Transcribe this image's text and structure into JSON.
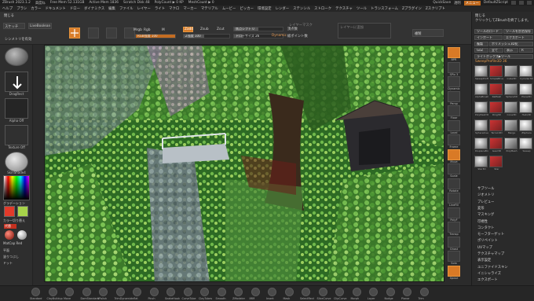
{
  "titlebar": {
    "app": "ZBrush 2023.1.2",
    "project": "高度ね",
    "free_mem": "Free Mem 52.131GB",
    "active_mem": "Active Mem 1836",
    "scratch_disk": "Scratch Disk 48",
    "poly_count": "PolyCount ▶ 0 KP",
    "mesh_count": "MeshCount ▶ 0",
    "quicksave": "QuickSave",
    "transparency": "透明",
    "menus": "メニュー",
    "default_script": "DefaultZScript"
  },
  "menubar": {
    "items": [
      "ヘルプ",
      "ブラシ",
      "カラー",
      "ドキュメント",
      "ドロー",
      "ダイナミクス",
      "編集",
      "ファイル",
      "レイヤー",
      "ライト",
      "マクロ",
      "マーカー",
      "マテリアル",
      "ムービー",
      "ピッカー",
      "環境設定",
      "レンダー",
      "ステンシル",
      "ストローク",
      "テクスチャ",
      "ツール",
      "トランスフォーム",
      "Zプラグイン",
      "Zスクリプト"
    ]
  },
  "toolbar": {
    "close_label": "閉じる",
    "quick_sketch": "スケッチ",
    "lightbox": "LiveBoolean",
    "sym": "シンメトリを有効",
    "mrgb": "Mrgb",
    "rgb": "Rgb",
    "m": "M",
    "zadd": "Zadd",
    "zsub": "Zsub",
    "zcut": "Zcut",
    "rgb_intensity": "RGB強度 100",
    "z_intensity": "Z強度 100",
    "focal_shift": "焦点シフト 0",
    "draw_size": "ドローサイズ 26",
    "dynamic": "Dynamic",
    "active_points": "頂点数",
    "total_points": "総ポイント数",
    "frame_mask": "レイヤーマスク",
    "tip": "レイヤーに追加"
  },
  "lefttray": {
    "brush_label": "DragRect",
    "alpha_label": "Alpha Off",
    "texture_label": "Texture Off",
    "material_label": "SkinShade4",
    "gradient_label": "グラデーション",
    "switch_color": "カラー切り替え",
    "alternate": "代替",
    "matcap": "MatCap Red",
    "flat": "平面",
    "color_fill": "塗りつぶし",
    "dots": "ドット",
    "main_color": "#e23a2a",
    "secondary_color": "#a7d34a"
  },
  "rightshelf": {
    "items": [
      "BPR",
      "SPix 3",
      "Dynamic",
      "Persp",
      "Floor",
      "Local",
      "Frame",
      "Move",
      "Scale",
      "Rotate",
      "LineFill",
      "PolyF",
      "Transp",
      "Ghost",
      "Solo",
      "Xpose"
    ]
  },
  "palette": {
    "close": "閉じる",
    "tip": "クリックしてZBrushを終了します。",
    "load_tool": "ツールのロード",
    "save_as": "ツールを別名保存",
    "import": "インポート",
    "export": "エクスポート",
    "clone": "複製",
    "make_polymesh": "ポリメッシュ3D化",
    "goz": "GoZ",
    "all": "全て",
    "visible": "表示",
    "r": "R",
    "lightbox_tools": "ライトボックス▶ツール",
    "current_tool": "SweepProfile3D 36",
    "tools": [
      "SweepProfile3D",
      "SimpleBrush",
      "Cube3D",
      "Cylinder3D",
      "AlphaBrush",
      "ReMesh",
      "Sphere3D",
      "Plane3D",
      "PolyMesh3D",
      "Ring3D",
      "Cone3D",
      "Helix3D",
      "SphereInverse",
      "Terrain3D",
      "Merge",
      "ZSphere",
      "DisplaceBrush",
      "Gear3D",
      "PolyMesh",
      "Sweep",
      "Star3D",
      "Star"
    ],
    "menu": [
      "サブツール",
      "ジオメトリ",
      "プレビュー",
      "変形",
      "マスキング",
      "可視性",
      "コンタクト",
      "モーフターゲット",
      "ポリペイント",
      "UVマップ",
      "テクスチャマップ",
      "表示設定",
      "ユニファイドスキン",
      "イニシャライズ",
      "エクスポート"
    ]
  },
  "bottombar": {
    "items": [
      "Standard",
      "ClayBuildup",
      "Move",
      "DamStandard",
      "hPolish",
      "TrimDynamic",
      "Inflat",
      "Pinch",
      "SnakeHook",
      "CurveTube",
      "ClayTubes",
      "Smooth",
      "ZModeler",
      "IMM",
      "Insert",
      "Mask",
      "SelectRect",
      "SliceCurve",
      "ClipCurve",
      "Morph",
      "Layer",
      "Nudge",
      "Planar",
      "Trim"
    ]
  }
}
